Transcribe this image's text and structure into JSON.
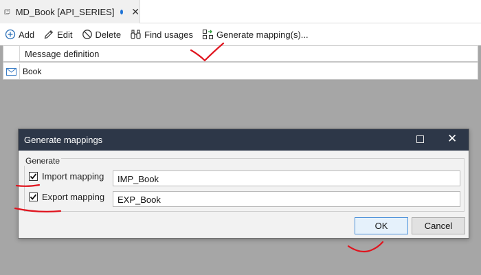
{
  "tab": {
    "title": "MD_Book [API_SERIES]",
    "close_glyph": "✕",
    "icon": "document-icon",
    "dirty_color": "#1e73d6"
  },
  "toolbar": {
    "add_label": "Add",
    "edit_label": "Edit",
    "delete_label": "Delete",
    "find_usages_label": "Find usages",
    "generate_label": "Generate mapping(s)..."
  },
  "grid": {
    "columns": [
      "Message definition"
    ],
    "rows": [
      {
        "icon": "envelope-icon",
        "name": "Book"
      }
    ]
  },
  "dialog": {
    "title": "Generate mappings",
    "group_label": "Generate",
    "import": {
      "label": "Import mapping",
      "checked": true,
      "value": "IMP_Book"
    },
    "export": {
      "label": "Export mapping",
      "checked": true,
      "value": "EXP_Book"
    },
    "ok_label": "OK",
    "cancel_label": "Cancel",
    "close_glyph": "✕"
  },
  "colors": {
    "title_bar": "#2d3748",
    "annotation": "#e0141e",
    "overlay": "#a6a6a6"
  }
}
